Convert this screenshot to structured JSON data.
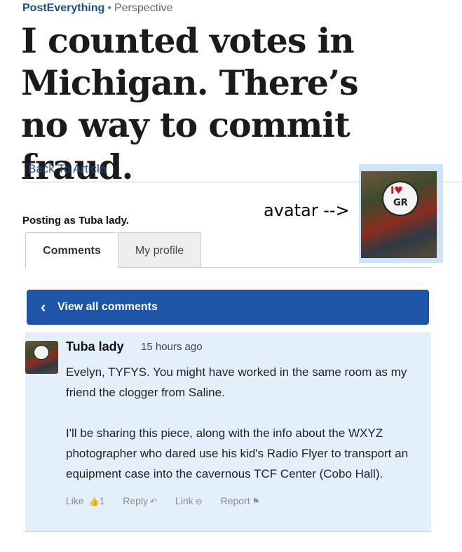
{
  "kicker": {
    "section": "PostEverything",
    "separator": "•",
    "label": "Perspective"
  },
  "headline": "I counted votes in Michigan. There’s no way to commit fraud.",
  "back_link": "Back To Article",
  "annotation": "avatar -->",
  "avatar_badge": {
    "top": "I♥",
    "bottom": "GR"
  },
  "posting_as": "Posting as Tuba lady.",
  "tabs": [
    {
      "label": "Comments",
      "active": true
    },
    {
      "label": "My profile",
      "active": false
    }
  ],
  "view_all": {
    "icon": "chevron-left-icon",
    "label": "View all comments"
  },
  "comment": {
    "author": "Tuba lady",
    "time": "15 hours ago",
    "paragraphs": [
      "Evelyn, TYFYS. You might have worked in the same room as my friend the clogger from Saline.",
      "I'll be sharing this piece, along with the info about the WXYZ photographer who dared use his kid's Radio Flyer to transport an equipment case into the cavernous TCF Center (Cobo Hall)."
    ],
    "actions": {
      "like_label": "Like",
      "like_count": "1",
      "reply_label": "Reply",
      "link_label": "Link",
      "report_label": "Report"
    }
  },
  "colors": {
    "brand_blue": "#1f55a6",
    "link_blue": "#1a4f8b",
    "comment_bg": "#e3f0fb"
  }
}
